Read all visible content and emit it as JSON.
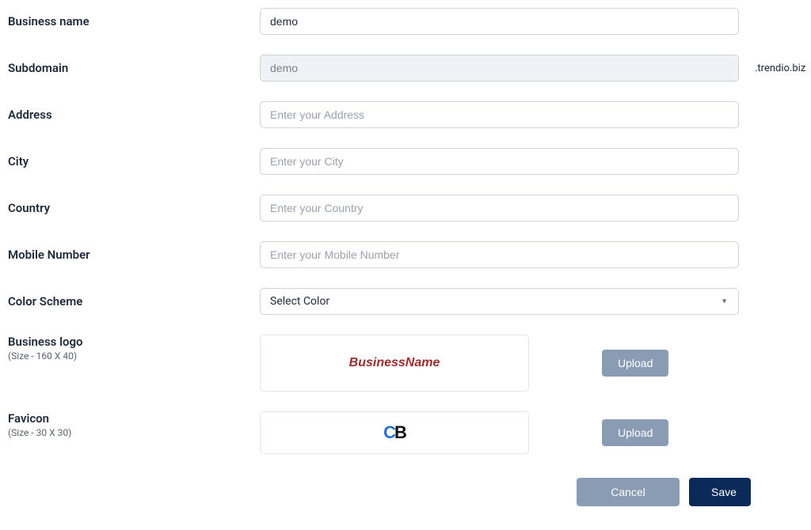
{
  "fields": {
    "business_name": {
      "label": "Business name",
      "value": "demo"
    },
    "subdomain": {
      "label": "Subdomain",
      "value": "demo",
      "suffix": ".trendio.biz"
    },
    "address": {
      "label": "Address",
      "placeholder": "Enter your Address"
    },
    "city": {
      "label": "City",
      "placeholder": "Enter your City"
    },
    "country": {
      "label": "Country",
      "placeholder": "Enter your Country"
    },
    "mobile": {
      "label": "Mobile Number",
      "placeholder": "Enter your Mobile Number"
    },
    "color_scheme": {
      "label": "Color Scheme",
      "placeholder": "Select Color"
    },
    "business_logo": {
      "label": "Business logo",
      "sub": "(Size - 160 X 40)",
      "preview_text": "BusinessName",
      "upload": "Upload"
    },
    "favicon": {
      "label": "Favicon",
      "sub": "(Size - 30 X 30)",
      "upload": "Upload"
    }
  },
  "actions": {
    "cancel": "Cancel",
    "save": "Save"
  }
}
